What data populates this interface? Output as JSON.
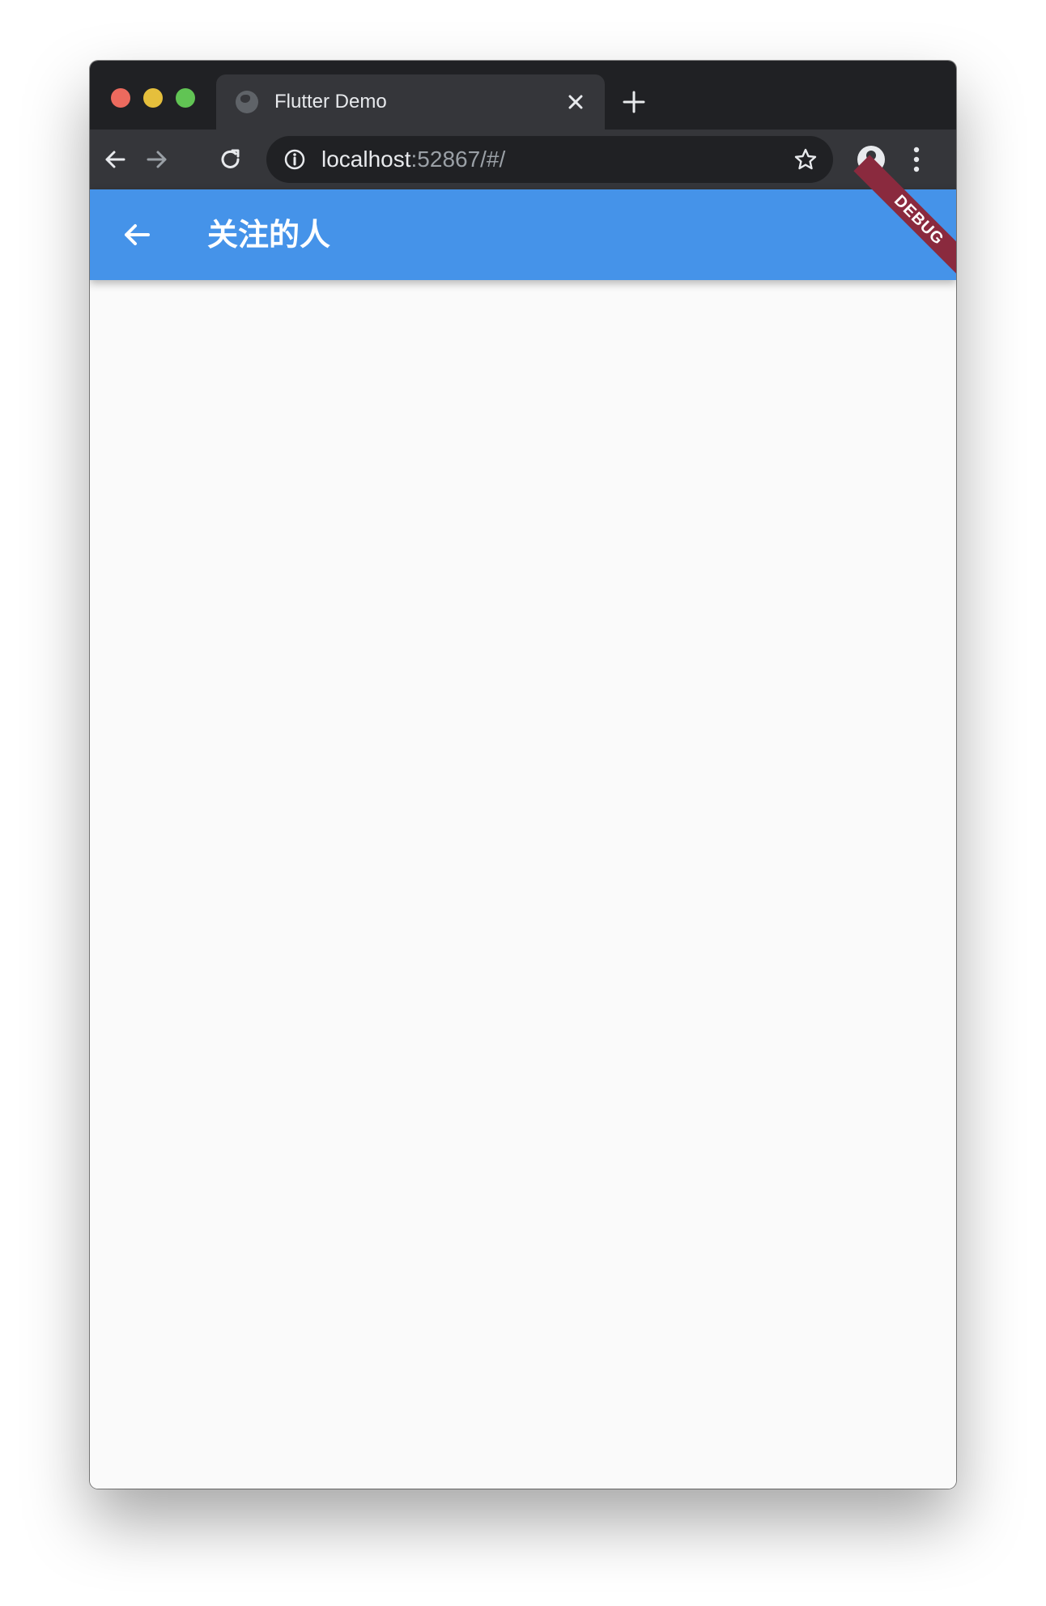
{
  "browser": {
    "tab": {
      "title": "Flutter Demo",
      "favicon": "globe-icon",
      "close_icon": "close-icon"
    },
    "new_tab_icon": "plus-icon",
    "toolbar": {
      "back_icon": "arrow-left-icon",
      "forward_icon": "arrow-right-icon",
      "reload_icon": "reload-icon",
      "site_info_icon": "info-icon",
      "bookmark_icon": "star-icon",
      "profile_icon": "account-circle-icon",
      "menu_icon": "more-vertical-icon"
    },
    "address_bar": {
      "host": "localhost",
      "rest": ":52867/#/"
    }
  },
  "app": {
    "appbar": {
      "title": "关注的人",
      "back_icon": "arrow-back-icon",
      "color": "#4593e9"
    },
    "debug_banner": "DEBUG",
    "background": "#fafafa"
  },
  "colors": {
    "traffic_red": "#ec6a5e",
    "traffic_yellow": "#e5bf3c",
    "traffic_green": "#61c454",
    "debug_banner": "#8a2a3e"
  }
}
